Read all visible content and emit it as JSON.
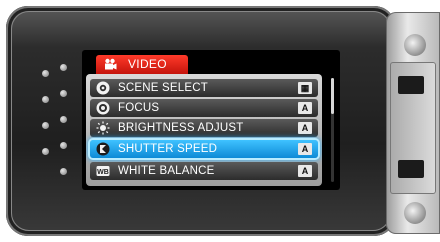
{
  "menu": {
    "title": "VIDEO",
    "items": [
      {
        "label": "SCENE SELECT",
        "icon": "scene-select-icon",
        "badge": "▦"
      },
      {
        "label": "FOCUS",
        "icon": "focus-icon",
        "badge": "A"
      },
      {
        "label": "BRIGHTNESS ADJUST",
        "icon": "brightness-icon",
        "badge": "A"
      },
      {
        "label": "SHUTTER SPEED",
        "icon": "shutter-speed-icon",
        "badge": "A",
        "selected": true
      },
      {
        "label": "WHITE BALANCE",
        "icon": "white-balance-icon",
        "badge": "A",
        "icon_text": "WB"
      }
    ]
  },
  "colors": {
    "title_bg": "#e0231a",
    "selected_bg": "#1aa3ec",
    "device_body": "#2a2a2a"
  }
}
